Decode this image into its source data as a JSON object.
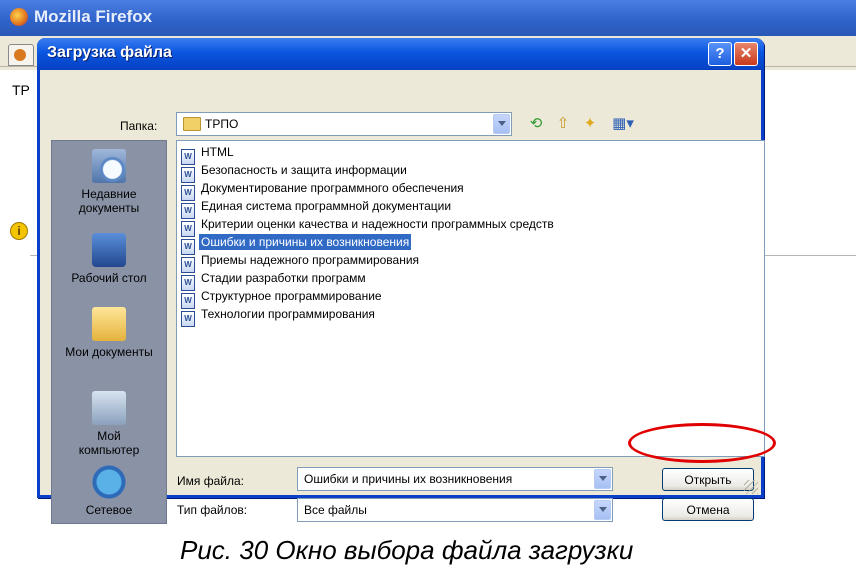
{
  "firefox": {
    "title": "Mozilla Firefox",
    "page_text": "ТР"
  },
  "dialog": {
    "title": "Загрузка файла",
    "help_label": "?",
    "close_label": "✕",
    "folder_label": "Папка:",
    "folder_value": "ТРПО",
    "places": [
      {
        "label": "Недавние документы",
        "icon": "recent-documents-icon"
      },
      {
        "label": "Рабочий стол",
        "icon": "desktop-icon"
      },
      {
        "label": "Мои документы",
        "icon": "my-documents-icon"
      },
      {
        "label": "Мой компьютер",
        "icon": "my-computer-icon"
      },
      {
        "label": "Сетевое",
        "icon": "network-icon"
      }
    ],
    "files": [
      "HTML",
      "Безопасность и защита информации",
      "Документирование программного обеспечения",
      "Единая система программной документации",
      "Критерии оценки качества и надежности программных средств",
      "Ошибки и причины их возникновения",
      "Приемы надежного программирования",
      "Стадии разработки программ",
      "Структурное программирование",
      "Технологии программирования"
    ],
    "selected_file_index": 5,
    "filename_label": "Имя файла:",
    "filename_value": "Ошибки и причины их возникновения",
    "filetype_label": "Тип файлов:",
    "filetype_value": "Все файлы",
    "open_button": "Открыть",
    "cancel_button": "Отмена"
  },
  "caption": "Рис. 30 Окно выбора файла загрузки"
}
